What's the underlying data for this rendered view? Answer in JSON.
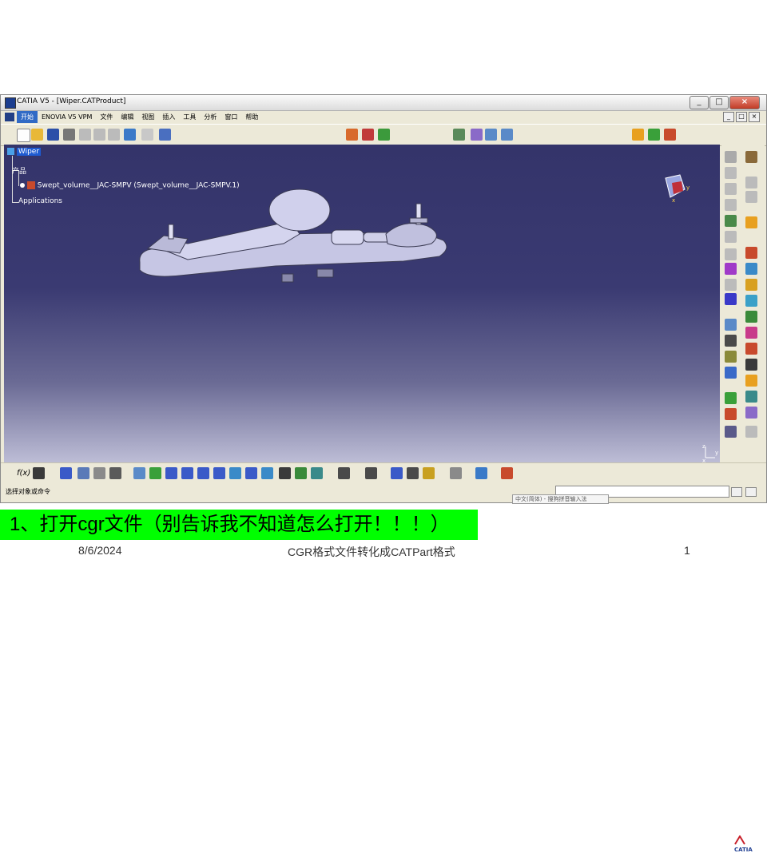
{
  "window": {
    "title": "CATIA V5 - [Wiper.CATProduct]",
    "controls": [
      "_",
      "□",
      "×"
    ],
    "mdi_controls": [
      "_",
      "□",
      "×"
    ]
  },
  "menu": {
    "items": [
      "开始",
      "ENOVIA V5 VPM",
      "文件",
      "编辑",
      "视图",
      "插入",
      "工具",
      "分析",
      "窗口",
      "帮助"
    ]
  },
  "tree": {
    "root": "Wiper",
    "product": "产品",
    "part": "Swept_volume__JAC-SMPV (Swept_volume__JAC-SMPV.1)",
    "applications": "Applications"
  },
  "compass": {
    "x_label": "x",
    "y_label": "y"
  },
  "axis_triad": {
    "x_label": "x",
    "y_label": "y",
    "z_label": "z"
  },
  "status": {
    "prompt": "选择对象或命令",
    "ime": "中文(简体) - 搜狗拼音输入法",
    "logo": "CATIA"
  },
  "bottom_toolbar": {
    "f_label": "f(x)"
  },
  "colors": {
    "viewport_top": "#34346a",
    "viewport_bottom": "#bdbdd6",
    "model": "#c6c6e4",
    "caption_bg": "#00ff00",
    "selection": "#1e5bd2"
  },
  "slide": {
    "caption": "1、打开cgr文件（别告诉我不知道怎么打开！！！）",
    "date": "8/6/2024",
    "footer_title": "CGR格式文件转化成CATPart格式",
    "page_number": "1"
  }
}
